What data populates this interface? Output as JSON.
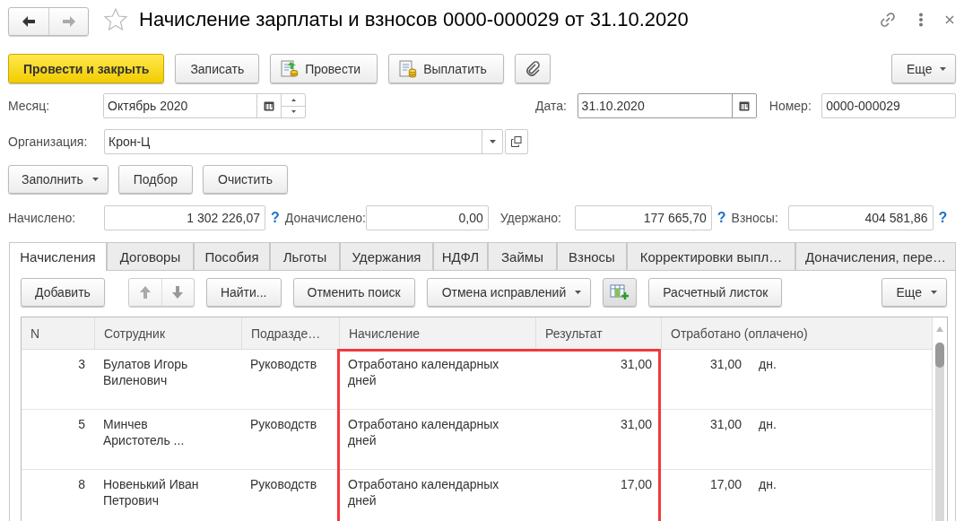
{
  "window": {
    "title": "Начисление зарплаты и взносов 0000-000029 от 31.10.2020",
    "favorite": false
  },
  "nav_buttons": [
    {
      "kind": "back",
      "disabled": false
    },
    {
      "kind": "forward",
      "disabled": true
    }
  ],
  "command_bar": [
    {
      "kind": "primary",
      "label": "Провести и закрыть"
    },
    {
      "kind": "plain",
      "label": "Записать"
    },
    {
      "kind": "post",
      "label": "Провести"
    },
    {
      "kind": "pay",
      "label": "Выплатить"
    },
    {
      "kind": "attach"
    }
  ],
  "more_button": {
    "label": "Еще"
  },
  "month": {
    "label": "Месяц:",
    "value": "Октябрь 2020"
  },
  "date": {
    "label": "Дата:",
    "value": "31.10.2020"
  },
  "number": {
    "label": "Номер:",
    "value": "0000-000029"
  },
  "organization": {
    "label": "Организация:",
    "value": "Крон-Ц"
  },
  "fill_buttons": [
    {
      "label": "Заполнить",
      "dropdown": true
    },
    {
      "label": "Подбор",
      "dropdown": false
    },
    {
      "label": "Очистить",
      "dropdown": false
    }
  ],
  "totals": [
    {
      "label": "Начислено:",
      "value": "1 302 226,07",
      "help": "?"
    },
    {
      "label": "Доначислено:",
      "value": "0,00"
    },
    {
      "label": "Удержано:",
      "value": "177 665,70",
      "help": "?"
    },
    {
      "label": "Взносы:",
      "value": "404 581,86",
      "help": "?"
    }
  ],
  "tabs": [
    {
      "label": "Начисления",
      "selected": true
    },
    {
      "label": "Договоры",
      "selected": false
    },
    {
      "label": "Пособия",
      "selected": false
    },
    {
      "label": "Льготы",
      "selected": false
    },
    {
      "label": "Удержания",
      "selected": false
    },
    {
      "label": "НДФЛ",
      "selected": false
    },
    {
      "label": "Займы",
      "selected": false
    },
    {
      "label": "Взносы",
      "selected": false
    },
    {
      "label": "Корректировки выпл…",
      "selected": false
    },
    {
      "label": "Доначисления, пере…",
      "selected": false
    }
  ],
  "table_toolbar": [
    {
      "kind": "button",
      "label": "Добавить"
    },
    {
      "kind": "move"
    },
    {
      "kind": "button",
      "label": "Найти..."
    },
    {
      "kind": "button",
      "label": "Отменить поиск"
    },
    {
      "kind": "menu",
      "label": "Отмена исправлений"
    },
    {
      "kind": "add-table"
    },
    {
      "kind": "button",
      "label": "Расчетный листок"
    },
    {
      "kind": "menu",
      "label": "Еще"
    }
  ],
  "table": {
    "highlight_frame": true,
    "columns": [
      {
        "label": "N"
      },
      {
        "label": "Сотрудник"
      },
      {
        "label": "Подразде…"
      },
      {
        "label": "Начисление"
      },
      {
        "label": "Результат"
      },
      {
        "label": "Отработано (оплачено)"
      }
    ],
    "rows": [
      {
        "n": "3",
        "employee": [
          "Булатов Игорь",
          "Виленович"
        ],
        "department": "Руководств",
        "accrual": [
          "Отработано календарных",
          "дней"
        ],
        "result": "31,00",
        "worked": "31,00",
        "unit": "дн."
      },
      {
        "n": "5",
        "employee": [
          "Минчев",
          "Аристотель ..."
        ],
        "department": "Руководств",
        "accrual": [
          "Отработано календарных",
          "дней"
        ],
        "result": "31,00",
        "worked": "31,00",
        "unit": "дн."
      },
      {
        "n": "8",
        "employee": [
          "Новенький Иван",
          "Петрович"
        ],
        "department": "Руководств",
        "accrual": [
          "Отработано календарных",
          "дней"
        ],
        "result": "17,00",
        "worked": "17,00",
        "unit": "дн."
      }
    ]
  }
}
